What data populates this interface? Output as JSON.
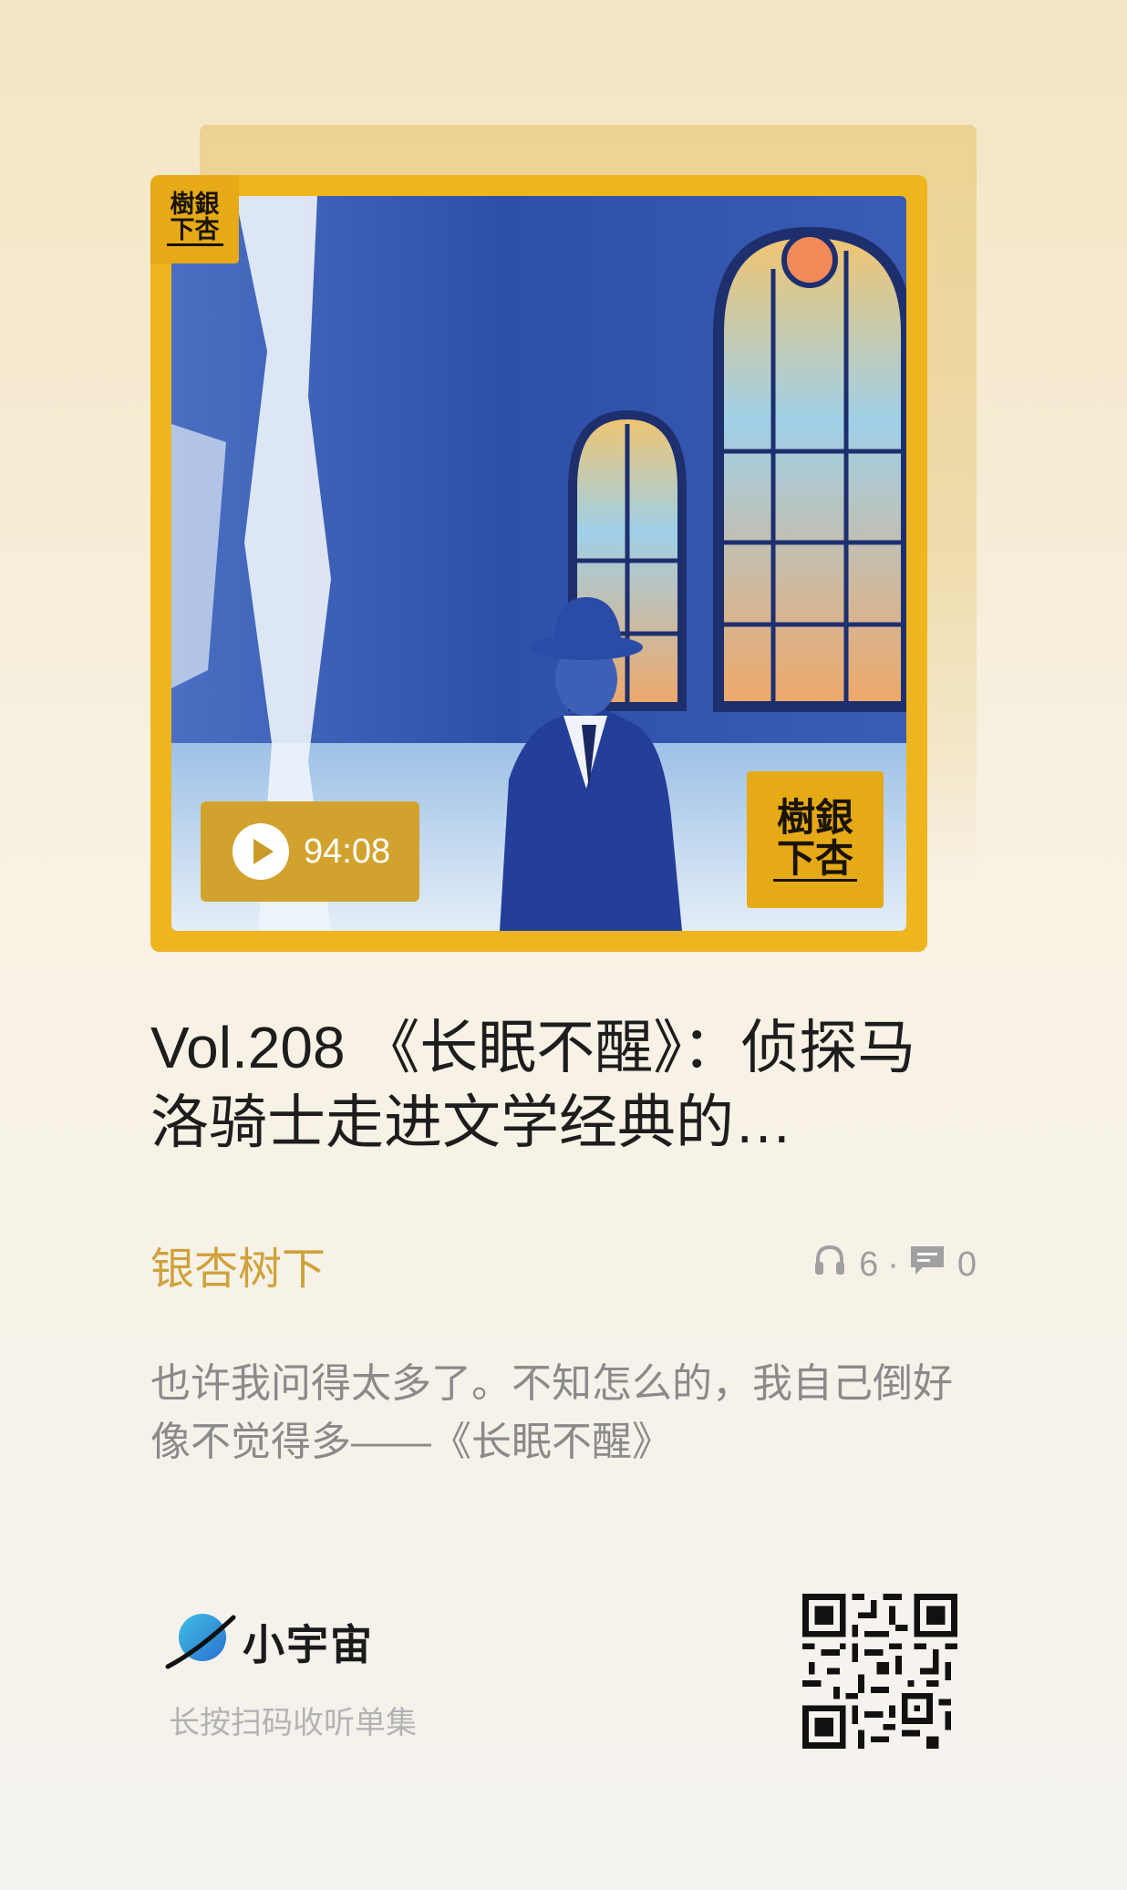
{
  "episode": {
    "duration": "94:08",
    "title": "Vol.208 《长眠不醒》：侦探马洛骑士走进文学经典的…",
    "podcast_name": "银杏树下",
    "listen_count": "6",
    "stats_separator": "·",
    "comment_count": "0",
    "description": "也许我问得太多了。不知怎么的，我自己倒好像不觉得多——《长眠不醒》"
  },
  "cover": {
    "badge_line1": "樹銀",
    "badge_line2": "下杏",
    "frame_color": "#eeb51e",
    "badge_color": "#e5aa16"
  },
  "footer": {
    "brand": "小宇宙",
    "hint": "长按扫码收听单集"
  },
  "colors": {
    "accent": "#cfa23b",
    "title": "#1d1d1d",
    "muted": "#8a8a8a"
  }
}
